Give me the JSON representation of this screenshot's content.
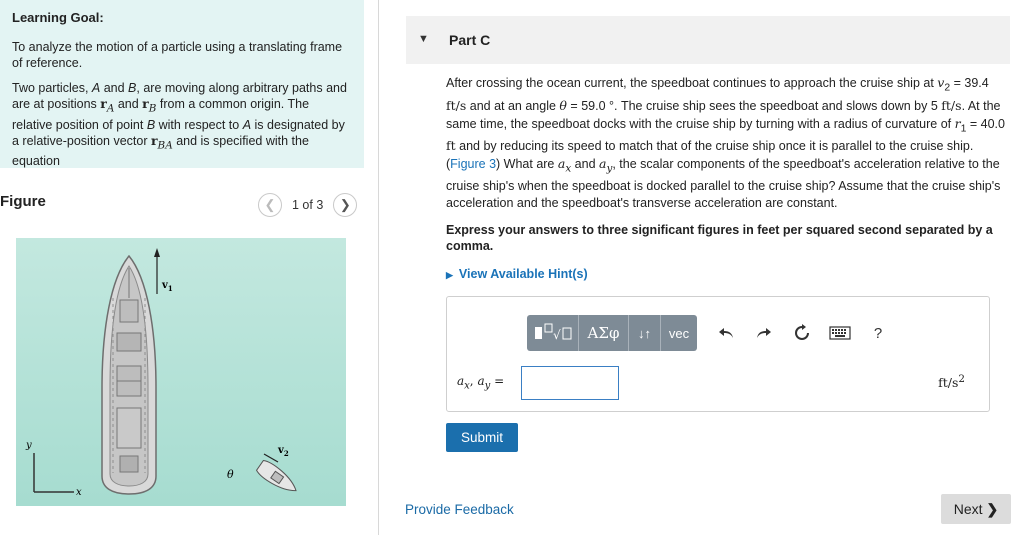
{
  "learning_goal": {
    "title": "Learning Goal:",
    "objective": "To analyze the motion of a particle using a translating frame of reference.",
    "description": {
      "p1": "Two particles, ",
      "A": "A",
      "p2": " and ",
      "B": "B",
      "p3": ", are moving along arbitrary paths and are at positions ",
      "rA": "r",
      "rA_sub": "A",
      "p4": " and ",
      "rB": "r",
      "rB_sub": "B",
      "p5": " from a common origin. The relative position of point ",
      "B2": "B",
      "p6": " with respect to ",
      "A2": "A",
      "p7": " is designated by a relative-position vector ",
      "rBA": "r",
      "rBA_sub": "BA",
      "p8": " and is specified with the equation"
    }
  },
  "figure": {
    "title": "Figure",
    "counter": "1 of 3",
    "prev_icon": "chevron-left-icon",
    "next_icon": "chevron-right-icon",
    "labels": {
      "v1": "v",
      "v1_sub": "1",
      "v2": "v",
      "v2_sub": "2",
      "theta": "θ",
      "y": "y",
      "x": "x"
    }
  },
  "part": {
    "title": "Part C",
    "question": {
      "t1": "After crossing the ocean current, the speedboat continues to approach the cruise ship at ",
      "v2": "v",
      "v2_sub": "2",
      "t2": " = 39.4 ",
      "unit1": "ft/s",
      "t3": " and at an angle ",
      "theta": "θ",
      "t4": " = 59.0 °. The cruise ship sees the speedboat and slows down by 5 ",
      "unit2": "ft/s",
      "t5": ". At the same time, the speedboat docks with the cruise ship by turning with a radius of curvature of ",
      "r1": "r",
      "r1_sub": "1",
      "t6": " = 40.0 ",
      "unit3": "ft",
      "t7": " and by reducing its speed to match that of the cruise ship once it is parallel to the cruise ship. (",
      "fig_link": "Figure 3",
      "t8": ") What are ",
      "ax": "a",
      "ax_sub": "x",
      "t9": " and ",
      "ay": "a",
      "ay_sub": "y",
      "t10": ", the scalar components of the speedboat's acceleration relative to the cruise ship's when the speedboat is docked parallel to the cruise ship? Assume that the cruise ship's acceleration and the speedboat's transverse acceleration are constant."
    },
    "instruction": "Express your answers to three significant figures in feet per squared second separated by a comma.",
    "hints_label": "View Available Hint(s)",
    "toolbar": {
      "templates_icon": "templates-icon",
      "greek_label": "ΑΣφ",
      "arrows_label": "↓↑",
      "vec_label": "vec",
      "undo_icon": "undo-icon",
      "redo_icon": "redo-icon",
      "reset_icon": "reset-icon",
      "keyboard_icon": "keyboard-icon",
      "help_label": "?"
    },
    "answer_label": "a",
    "answer_label_sub_x": "x",
    "answer_label_mid": ", ",
    "answer_label_a2": "a",
    "answer_label_sub_y": "y",
    "answer_label_eq": " =",
    "answer_value": "",
    "units": "ft/s",
    "units_sup": "2",
    "submit_label": "Submit",
    "feedback_label": "Provide Feedback",
    "next_label": "Next"
  },
  "colors": {
    "goal_bg": "#e3f4f3",
    "submit": "#1b6fad",
    "link": "#1a73b8",
    "toolbar_grey": "#7e8b96",
    "figure_water": "#b3e2d7"
  }
}
